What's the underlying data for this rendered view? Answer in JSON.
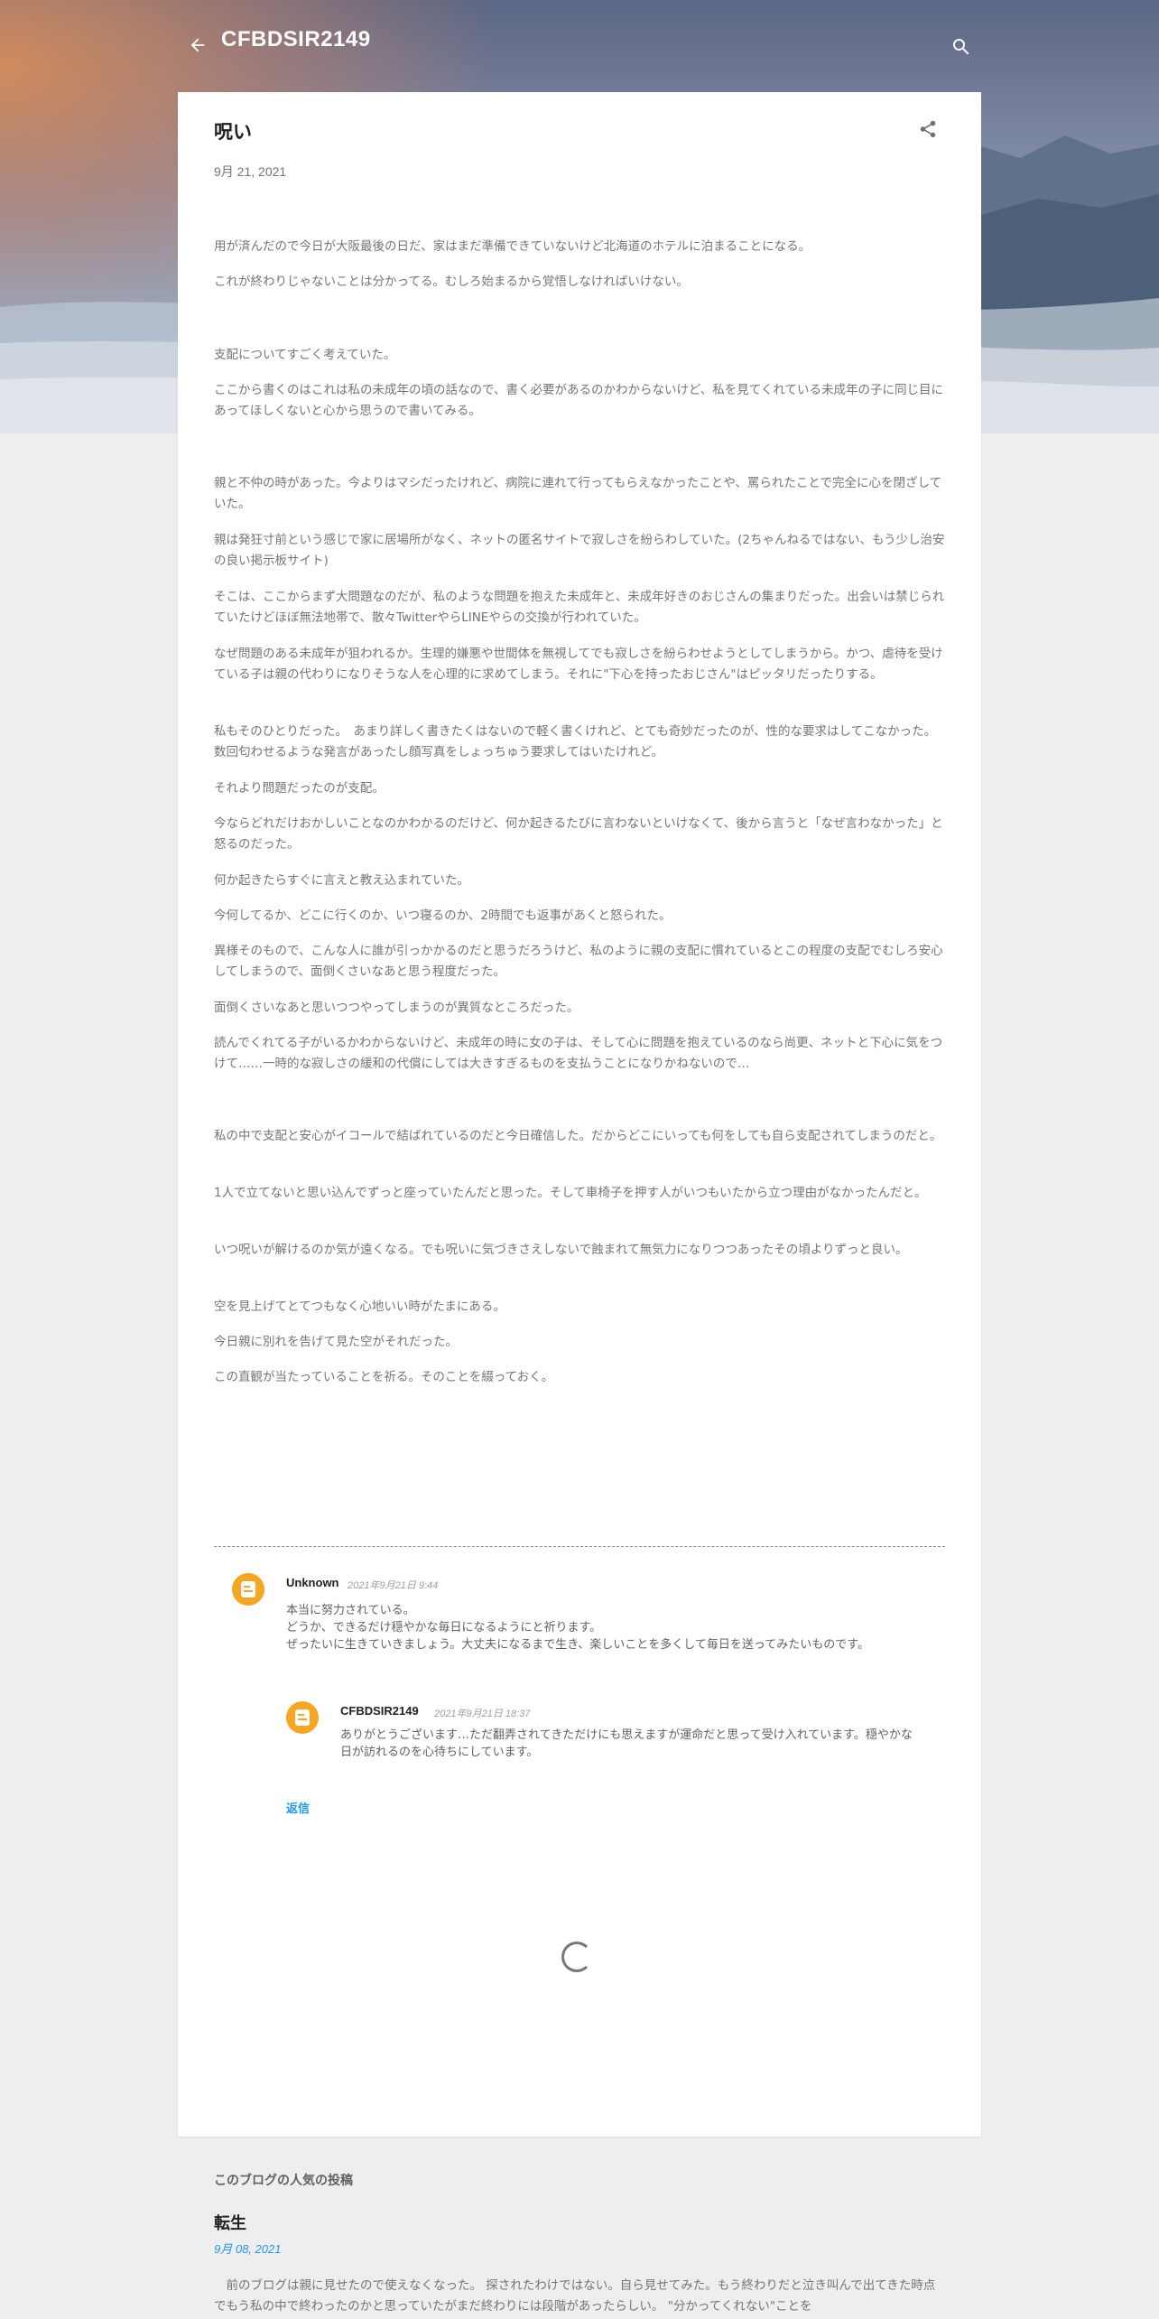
{
  "header": {
    "blog_title": "CFBDSIR2149",
    "back_icon": "arrow-left-icon",
    "search_icon": "search-icon"
  },
  "post": {
    "title": "呪い",
    "date": "9月 21, 2021",
    "share_icon": "share-icon",
    "paragraphs": [
      "用が済んだので今日が大阪最後の日だ、家はまだ準備できていないけど北海道のホテルに泊まることになる。",
      "これが終わりじゃないことは分かってる。むしろ始まるから覚悟しなければいけない。",
      "支配についてすごく考えていた。",
      "ここから書くのはこれは私の未成年の頃の話なので、書く必要があるのかわからないけど、私を見てくれている未成年の子に同じ目にあってほしくないと心から思うので書いてみる。",
      "親と不仲の時があった。今よりはマシだったけれど、病院に連れて行ってもらえなかったことや、罵られたことで完全に心を閉ざしていた。",
      "親は発狂寸前という感じで家に居場所がなく、ネットの匿名サイトで寂しさを紛らわしていた。(2ちゃんねるではない、もう少し治安の良い掲示板サイト)",
      "そこは、ここからまず大問題なのだが、私のような問題を抱えた未成年と、未成年好きのおじさんの集まりだった。出会いは禁じられていたけどほぼ無法地帯で、散々TwitterやらLINEやらの交換が行われていた。",
      "なぜ問題のある未成年が狙われるか。生理的嫌悪や世間体を無視してでも寂しさを紛らわせようとしてしまうから。かつ、虐待を受けている子は親の代わりになりそうな人を心理的に求めてしまう。それに\"下心を持ったおじさん\"はピッタリだったりする。",
      "私もそのひとりだった。　あまり詳しく書きたくはないので軽く書くけれど、とても奇妙だったのが、性的な要求はしてこなかった。数回匂わせるような発言があったし顔写真をしょっちゅう要求してはいたけれど。",
      "それより問題だったのが支配。",
      "今ならどれだけおかしいことなのかわかるのだけど、何か起きるたびに言わないといけなくて、後から言うと「なぜ言わなかった」と怒るのだった。",
      "何か起きたらすぐに言えと教え込まれていた。",
      "今何してるか、どこに行くのか、いつ寝るのか、2時間でも返事があくと怒られた。",
      "異様そのもので、こんな人に誰が引っかかるのだと思うだろうけど、私のように親の支配に慣れているとこの程度の支配でむしろ安心してしまうので、面倒くさいなあと思う程度だった。",
      "面倒くさいなあと思いつつやってしまうのが異質なところだった。",
      "読んでくれてる子がいるかわからないけど、未成年の時に女の子は、そして心に問題を抱えているのなら尚更、ネットと下心に気をつけて……一時的な寂しさの緩和の代償にしては大きすぎるものを支払うことになりかねないので…",
      "私の中で支配と安心がイコールで結ばれているのだと今日確信した。だからどこにいっても何をしても自ら支配されてしまうのだと。",
      "1人で立てないと思い込んでずっと座っていたんだと思った。そして車椅子を押す人がいつもいたから立つ理由がなかったんだと。",
      "いつ呪いが解けるのか気が遠くなる。でも呪いに気づきさえしないで蝕まれて無気力になりつつあったその頃よりずっと良い。",
      "空を見上げてとてつもなく心地いい時がたまにある。",
      "今日親に別れを告げて見た空がそれだった。",
      "この直観が当たっていることを祈る。そのことを綴っておく。"
    ]
  },
  "comments": [
    {
      "author": "Unknown",
      "time": "2021年9月21日 9:44",
      "lines": [
        "本当に努力されている。",
        "どうか、できるだけ穏やかな毎日になるようにと祈ります。",
        "ぜったいに生きていきましょう。大丈夫になるまで生き、楽しいことを多くして毎日を送ってみたいものです。"
      ],
      "reply": {
        "author": "CFBDSIR2149",
        "time": "2021年9月21日 18:37",
        "text": "ありがとうございます…ただ翻弄されてきただけにも思えますが運命だと思って受け入れています。穏やかな日が訪れるのを心待ちにしています。"
      }
    }
  ],
  "reply_label": "返信",
  "popular": {
    "section_label": "このブログの人気の投稿",
    "title": "転生",
    "date": "9月 08, 2021",
    "snippet": "　前のブログは親に見せたので使えなくなった。 探されたわけではない。自ら見せてみた。もう終わりだと泣き叫んで出てきた時点でもう私の中で終わったのかと思っていたがまだ終わりには段階があったらしい。 \"分かってくれない\"ことを"
  },
  "colors": {
    "background": "#eeeeee",
    "card": "#ffffff",
    "link": "#2196f3",
    "avatar": "#f5a623"
  }
}
